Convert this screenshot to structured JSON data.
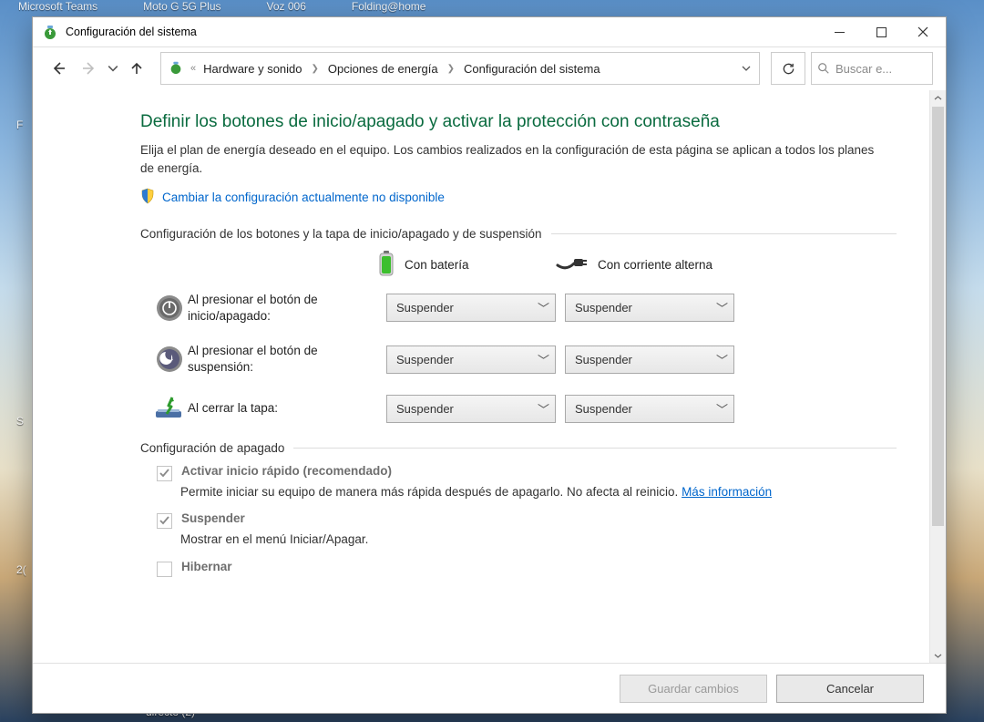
{
  "desktop": {
    "top_labels": [
      "Microsoft Teams",
      "Moto G 5G Plus",
      "Voz 006",
      "Folding@home"
    ],
    "side_labels": [
      {
        "t": 130,
        "text": "F"
      },
      {
        "t": 455,
        "text": "S"
      },
      {
        "t": 618,
        "text": "2("
      }
    ],
    "bottom_label": "directo (2)"
  },
  "window": {
    "title": "Configuración del sistema"
  },
  "breadcrumb": {
    "prefix": "«",
    "items": [
      "Hardware y sonido",
      "Opciones de energía",
      "Configuración del sistema"
    ]
  },
  "search": {
    "placeholder": "Buscar e..."
  },
  "page": {
    "heading": "Definir los botones de inicio/apagado y activar la protección con contraseña",
    "description": "Elija el plan de energía deseado en el equipo. Los cambios realizados en la configuración de esta página se aplican a todos los planes de energía.",
    "change_link": "Cambiar la configuración actualmente no disponible"
  },
  "section1": {
    "title": "Configuración de los botones y la tapa de inicio/apagado y de suspensión",
    "col_battery": "Con batería",
    "col_ac": "Con corriente alterna",
    "rows": [
      {
        "label": "Al presionar el botón de inicio/apagado:",
        "battery": "Suspender",
        "ac": "Suspender"
      },
      {
        "label": "Al presionar el botón de suspensión:",
        "battery": "Suspender",
        "ac": "Suspender"
      },
      {
        "label": "Al cerrar la tapa:",
        "battery": "Suspender",
        "ac": "Suspender"
      }
    ]
  },
  "section2": {
    "title": "Configuración de apagado",
    "items": [
      {
        "label": "Activar inicio rápido (recomendado)",
        "checked": true,
        "desc_pre": "Permite iniciar su equipo de manera más rápida después de apagarlo. No afecta al reinicio. ",
        "desc_link": "Más información"
      },
      {
        "label": "Suspender",
        "checked": true,
        "desc_pre": "Mostrar en el menú Iniciar/Apagar.",
        "desc_link": ""
      },
      {
        "label": "Hibernar",
        "checked": false,
        "desc_pre": "",
        "desc_link": ""
      }
    ]
  },
  "footer": {
    "save": "Guardar cambios",
    "cancel": "Cancelar"
  }
}
